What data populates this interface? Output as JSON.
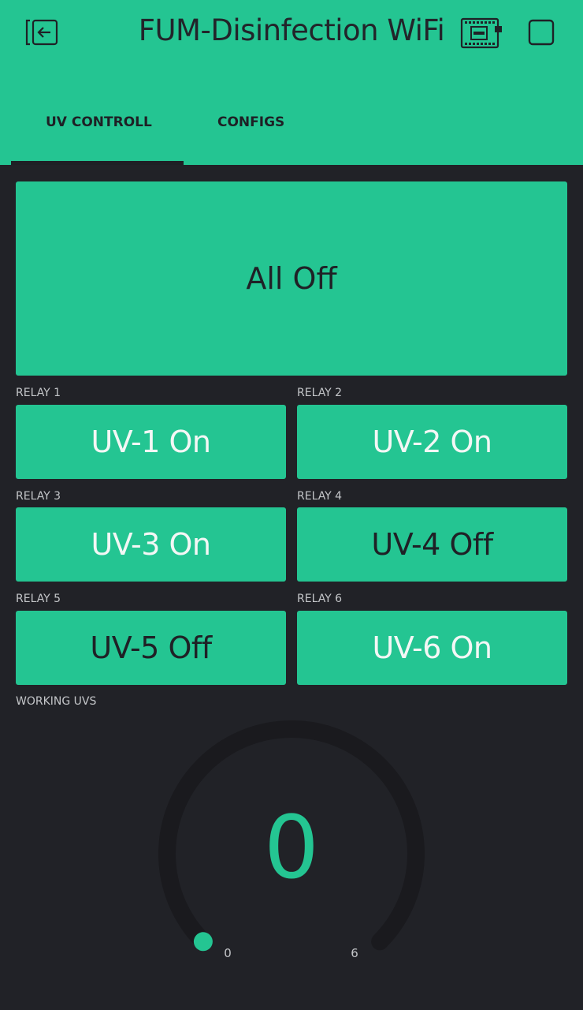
{
  "header": {
    "title": "FUM-Disinfection WiFi",
    "icons": [
      "exit-icon",
      "device-icon",
      "stop-icon"
    ]
  },
  "tabs": [
    {
      "label": "UV CONTROLL",
      "active": true
    },
    {
      "label": "CONFIGS",
      "active": false
    }
  ],
  "master_button": {
    "label": "All Off"
  },
  "relays": [
    {
      "label": "RELAY 1",
      "button": "UV-1 On",
      "state": "on"
    },
    {
      "label": "RELAY 2",
      "button": "UV-2 On",
      "state": "on"
    },
    {
      "label": "RELAY 3",
      "button": "UV-3 On",
      "state": "on"
    },
    {
      "label": "RELAY 4",
      "button": "UV-4 Off",
      "state": "off"
    },
    {
      "label": "RELAY 5",
      "button": "UV-5 Off",
      "state": "off"
    },
    {
      "label": "RELAY 6",
      "button": "UV-6 On",
      "state": "on"
    }
  ],
  "gauge": {
    "label": "WORKING UVS",
    "value": "0",
    "min": "0",
    "max": "6"
  },
  "colors": {
    "accent": "#24c592",
    "background": "#212227",
    "gauge_track": "#1a1a1e",
    "dark_text": "#1f2126",
    "light_text": "#f3f7f5"
  }
}
